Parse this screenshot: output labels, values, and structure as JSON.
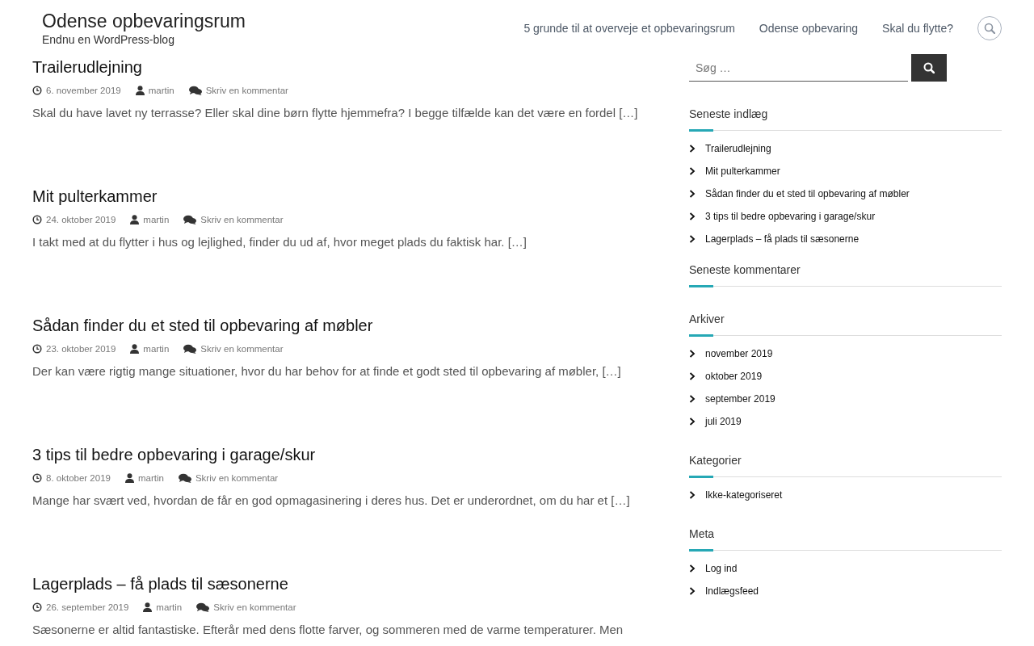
{
  "site": {
    "title": "Odense opbevaringsrum",
    "tagline": "Endnu en WordPress-blog"
  },
  "nav": [
    {
      "label": "5 grunde til at overveje et opbevaringsrum"
    },
    {
      "label": "Odense opbevaring"
    },
    {
      "label": "Skal du flytte?"
    }
  ],
  "posts": [
    {
      "title": "Trailerudlejning",
      "date": "6. november 2019",
      "author": "martin",
      "comments": "Skriv en kommentar",
      "excerpt": "Skal du have lavet ny terrasse? Eller skal dine børn flytte hjemmefra? I begge tilfælde kan det være en fordel […]"
    },
    {
      "title": "Mit pulterkammer",
      "date": "24. oktober 2019",
      "author": "martin",
      "comments": "Skriv en kommentar",
      "excerpt": "I takt med at du flytter i hus og lejlighed, finder du ud af, hvor meget plads du faktisk har. […]"
    },
    {
      "title": "Sådan finder du et sted til opbevaring af møbler",
      "date": "23. oktober 2019",
      "author": "martin",
      "comments": "Skriv en kommentar",
      "excerpt": "Der kan være rigtig mange situationer, hvor du har behov for at finde et godt sted til opbevaring af møbler, […]"
    },
    {
      "title": "3 tips til bedre opbevaring i garage/skur",
      "date": "8. oktober 2019",
      "author": "martin",
      "comments": "Skriv en kommentar",
      "excerpt": "Mange har svært ved, hvordan de får en god opmagasinering i deres hus. Det er underordnet, om du har et […]"
    },
    {
      "title": "Lagerplads – få plads til sæsonerne",
      "date": "26. september 2019",
      "author": "martin",
      "comments": "Skriv en kommentar",
      "excerpt": "Sæsonerne er altid fantastiske. Efterår med dens flotte farver, og sommeren med de varme temperaturer. Men"
    }
  ],
  "search": {
    "placeholder": "Søg …"
  },
  "widgets": [
    {
      "title": "Seneste indlæg",
      "items": [
        "Trailerudlejning",
        "Mit pulterkammer",
        "Sådan finder du et sted til opbevaring af møbler",
        "3 tips til bedre opbevaring i garage/skur",
        "Lagerplads – få plads til sæsonerne"
      ]
    },
    {
      "title": "Seneste kommentarer"
    },
    {
      "title": "Arkiver",
      "items": [
        "november 2019",
        "oktober 2019",
        "september 2019",
        "juli 2019"
      ]
    },
    {
      "title": "Kategorier",
      "items": [
        "Ikke-kategoriseret"
      ]
    },
    {
      "title": "Meta",
      "items": [
        "Log ind",
        "Indlægsfeed"
      ]
    }
  ]
}
